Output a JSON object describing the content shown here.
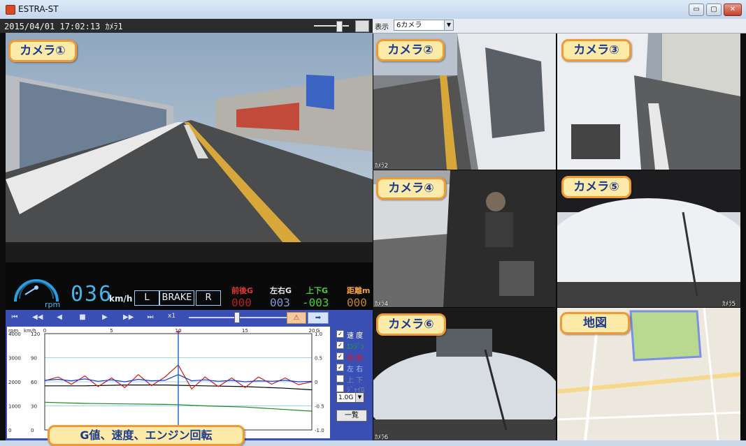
{
  "window": {
    "title": "ESTRA-ST",
    "min_label": "▭",
    "max_label": "▢",
    "close_label": "✕"
  },
  "info": {
    "datetime": "2015/04/01 17:02:13 ｶﾒﾗ1"
  },
  "view": {
    "label": "表示",
    "selected": "6カメラ"
  },
  "cameras": {
    "c1": "カメラ①",
    "c2": "カメラ②",
    "c3": "カメラ③",
    "c4": "カメラ④",
    "c5": "カメラ⑤",
    "c6": "カメラ⑥",
    "map": "地図",
    "graph_callout": "G値、速度、エンジン回転",
    "tag2": "ｶﾒﾗ2",
    "tag4": "ｶﾒﾗ4",
    "tag5": "ｶﾒﾗ5",
    "tag6": "ｶﾒﾗ6"
  },
  "dashboard": {
    "speed": "036",
    "speed_unit": "km/h",
    "rpm_unit": "rpm",
    "left": "L",
    "brake": "BRAKE",
    "right": "R",
    "fb_label": "前後G",
    "fb_value": "000",
    "lr_label": "左右G",
    "lr_value": "003",
    "ud_label": "上下G",
    "ud_value": "-003",
    "dist_label": "距離m",
    "dist_value": "000"
  },
  "playback": {
    "speed_label": "x1",
    "warn_icon": "⚠",
    "next_icon": "➡",
    "buttons": [
      "⏮",
      "◀◀",
      "◀",
      "■",
      "▶",
      "▶▶",
      "⏭"
    ]
  },
  "graph": {
    "rpm_unit": "rpm",
    "speed_unit": "km/h",
    "g_unit": "G",
    "x_ticks": [
      "0",
      "5",
      "10",
      "15",
      "20"
    ],
    "rpm_ticks": [
      "4000",
      "3000",
      "2000",
      "1000",
      "0"
    ],
    "speed_ticks": [
      "120",
      "90",
      "60",
      "30",
      "0"
    ],
    "g_ticks": [
      "1.0",
      "0.5",
      "0",
      "-0.5",
      "-1.0"
    ]
  },
  "checks": [
    {
      "label": "速 度",
      "checked": true,
      "color": "#ffffff"
    },
    {
      "label": "ｴﾝｼﾞﾝ",
      "checked": true,
      "color": "#1db300"
    },
    {
      "label": "前 後",
      "checked": true,
      "color": "#e31b1b"
    },
    {
      "label": "左 右",
      "checked": true,
      "color": "#9fbbff"
    },
    {
      "label": "上 下",
      "checked": false,
      "color": "#7f8bb0"
    },
    {
      "label": "ｼﾞｬｲﾛ",
      "checked": false,
      "color": "#7f8bb0"
    }
  ],
  "g_range": "1.0G",
  "list_button": "一覧",
  "chart_data": {
    "type": "line",
    "x_range": [
      0,
      20
    ],
    "cursor_x": 10,
    "series": [
      {
        "axis": "speed",
        "color": "#000000",
        "x": [
          0,
          3,
          6,
          9,
          12,
          15,
          18,
          20
        ],
        "y": [
          55,
          55,
          56,
          56,
          55,
          54,
          52,
          50
        ]
      },
      {
        "axis": "rpm",
        "color": "#1a8a1a",
        "x": [
          0,
          3,
          6,
          9,
          10,
          12,
          15,
          18,
          20
        ],
        "y": [
          1150,
          1100,
          1080,
          1060,
          1050,
          1000,
          950,
          850,
          780
        ]
      },
      {
        "axis": "g",
        "color": "#d41a1a",
        "x": [
          0,
          1,
          2,
          3,
          4,
          5,
          6,
          7,
          8,
          9,
          10,
          11,
          12,
          13,
          14,
          15,
          16,
          17,
          18,
          19,
          20
        ],
        "y": [
          0.02,
          0.1,
          -0.05,
          0.12,
          -0.1,
          0.08,
          -0.12,
          0.15,
          -0.08,
          0.1,
          0.35,
          -0.15,
          0.1,
          -0.1,
          0.08,
          -0.12,
          0.1,
          -0.05,
          0.08,
          -0.06,
          0.0
        ]
      },
      {
        "axis": "g",
        "color": "#1a3ad4",
        "x": [
          0,
          1,
          2,
          3,
          4,
          5,
          6,
          7,
          8,
          9,
          10,
          11,
          12,
          13,
          14,
          15,
          16,
          17,
          18,
          19,
          20
        ],
        "y": [
          0.03,
          0.05,
          0.02,
          0.06,
          0.01,
          0.04,
          0.0,
          0.05,
          0.02,
          0.03,
          0.15,
          0.02,
          0.04,
          0.01,
          0.03,
          0.0,
          0.02,
          0.01,
          0.03,
          0.0,
          0.01
        ]
      }
    ],
    "axes": {
      "rpm": [
        0,
        4000
      ],
      "speed": [
        0,
        120
      ],
      "g": [
        -1.0,
        1.0
      ]
    }
  }
}
